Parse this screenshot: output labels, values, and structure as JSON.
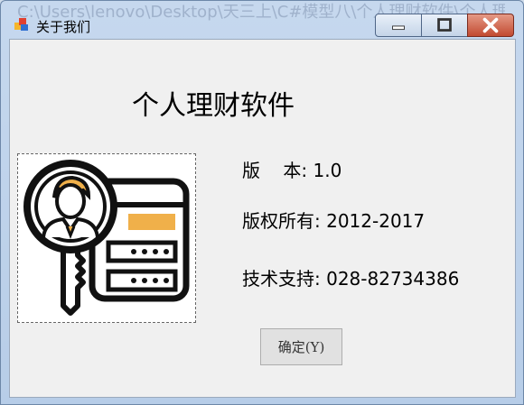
{
  "window": {
    "title": "关于我们",
    "background_path": "C:\\Users\\lenovo\\Desktop\\天三上\\C#模型八\\个人理财软件\\个人理财"
  },
  "about": {
    "heading": "个人理财软件",
    "version_label": "版    本:",
    "version_value": "1.0",
    "copyright_label": "版权所有:",
    "copyright_value": "2012-2017",
    "support_label": "技术支持:",
    "support_value": "028-82734386"
  },
  "buttons": {
    "ok_label": "确定(Y)"
  },
  "icons": {
    "app": "app-icon",
    "minimize": "minimize-icon",
    "maximize": "maximize-icon",
    "close": "close-icon",
    "logo": "magnifier-person-card-key-icon"
  },
  "colors": {
    "close_red": "#c8503a",
    "accent_orange": "#f0b04a",
    "client_bg": "#f0f0f0"
  }
}
